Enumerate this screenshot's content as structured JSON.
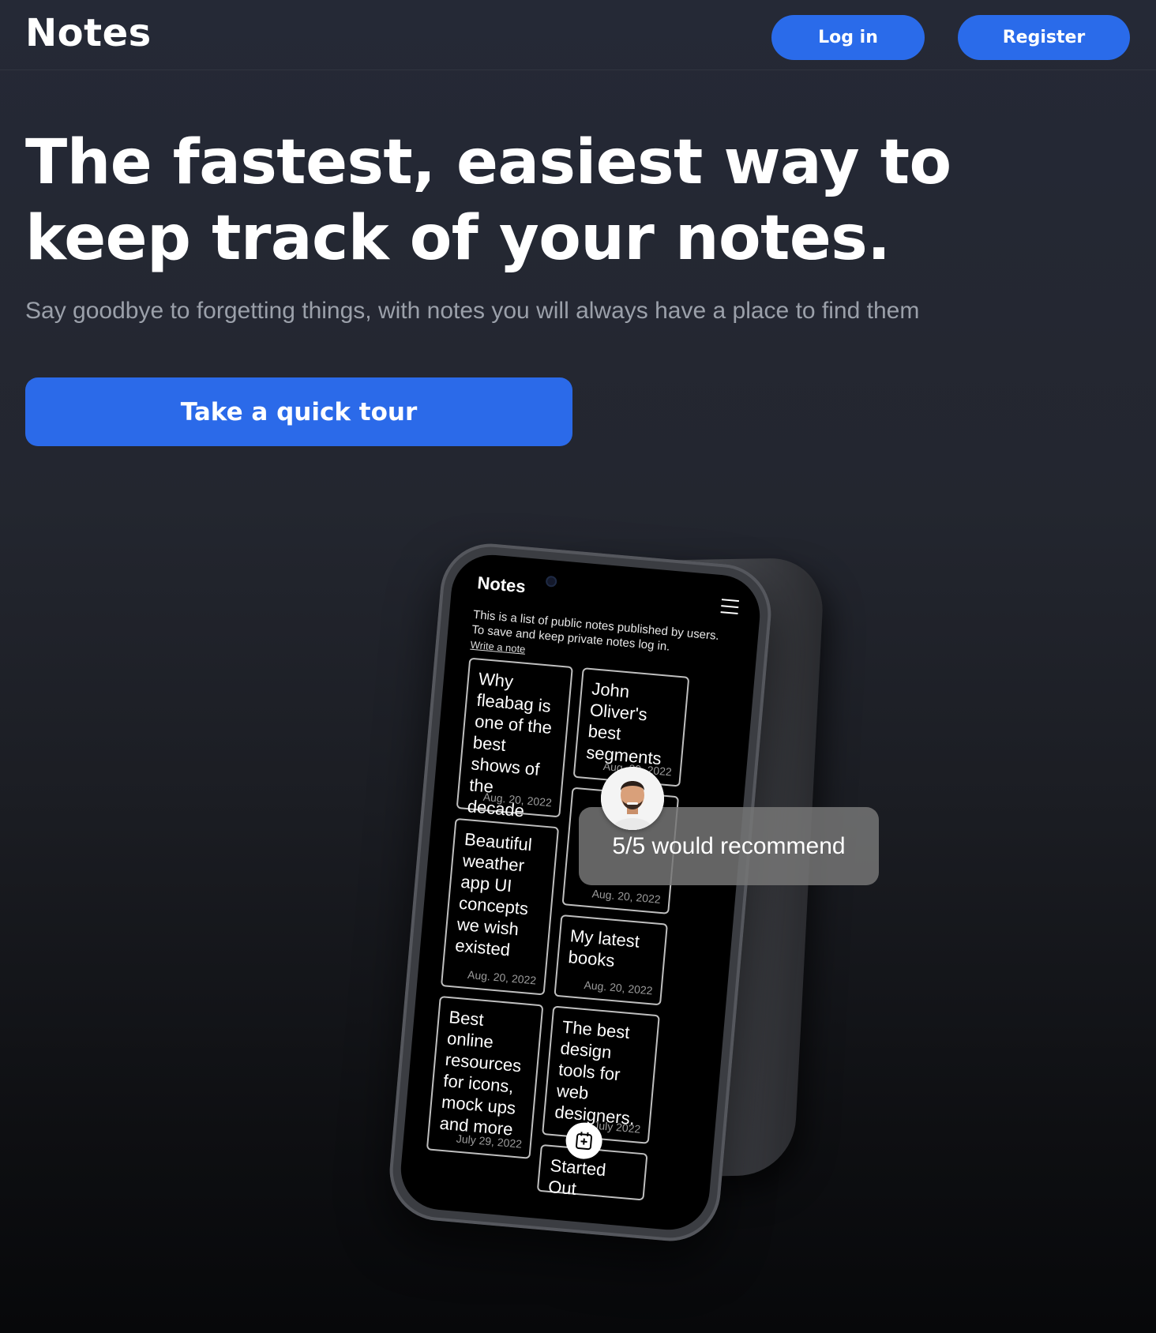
{
  "header": {
    "brand": "Notes",
    "login_label": "Log in",
    "register_label": "Register"
  },
  "hero": {
    "title": "The fastest, easiest way to keep track of your notes.",
    "subtitle": "Say goodbye to forgetting things, with notes you will always have a place to find them",
    "cta_label": "Take a quick tour"
  },
  "phone": {
    "app_title": "Notes",
    "intro": "This is a list of public notes published by users. To save and keep private notes log in.",
    "write_link": "Write a note",
    "notes": [
      {
        "title": "Why fleabag is one of the best shows of the decade",
        "date": "Aug. 20, 2022"
      },
      {
        "title": "John Oliver's best segments",
        "date": "Aug. 20, 2022"
      },
      {
        "title": "Beautiful weather app UI concepts we wish existed",
        "date": "Aug. 20, 2022"
      },
      {
        "title": "",
        "date": "Aug. 20, 2022"
      },
      {
        "title": "My latest books",
        "date": "Aug. 20, 2022"
      },
      {
        "title": "Best online resources for icons, mock ups and more",
        "date": "July 29, 2022"
      },
      {
        "title": "The best design tools for web designers.",
        "date": "July 2022"
      },
      {
        "title": "Started Out",
        "date": ""
      }
    ]
  },
  "review": {
    "text": "5/5 would recommend"
  },
  "colors": {
    "accent": "#2a6bea",
    "background": "#23262f",
    "subtitle": "#9ba0aa"
  }
}
